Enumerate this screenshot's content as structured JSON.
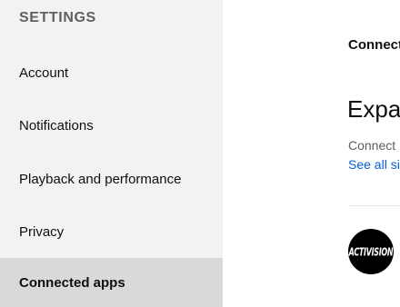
{
  "sidebar": {
    "title": "SETTINGS",
    "items": [
      {
        "label": "Account",
        "active": false
      },
      {
        "label": "Notifications",
        "active": false
      },
      {
        "label": "Playback and performance",
        "active": false
      },
      {
        "label": "Privacy",
        "active": false
      },
      {
        "label": "Connected apps",
        "active": true
      }
    ]
  },
  "main": {
    "page_label": "Connect",
    "heading": "Expar",
    "description": "Connect",
    "link": "See all si",
    "apps": [
      {
        "logo_text": "ACTIVISION"
      }
    ]
  },
  "colors": {
    "sidebar_bg": "#f2f2f2",
    "active_item_bg": "#d9d9d9",
    "link": "#065fd4"
  }
}
